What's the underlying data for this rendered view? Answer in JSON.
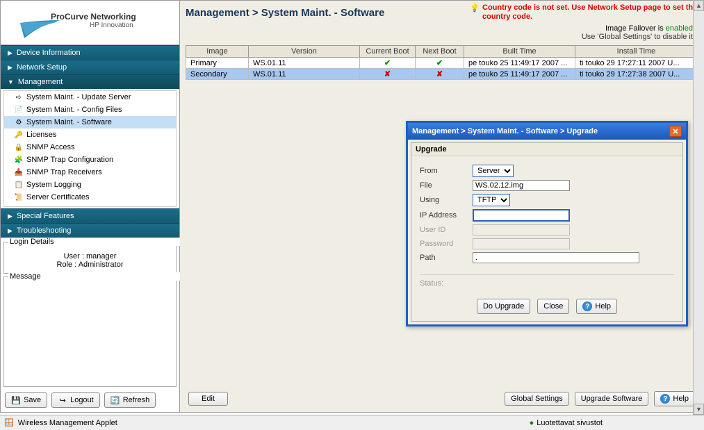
{
  "logo": {
    "brand": "ProCurve Networking",
    "sub": "HP Innovation"
  },
  "nav": {
    "device_info": "Device Information",
    "network_setup": "Network Setup",
    "management": "Management",
    "special_features": "Special Features",
    "troubleshooting": "Troubleshooting"
  },
  "tree": {
    "items": [
      {
        "label": "System Maint. - Update Server"
      },
      {
        "label": "System Maint. - Config Files"
      },
      {
        "label": "System Maint. - Software"
      },
      {
        "label": "Licenses"
      },
      {
        "label": "SNMP Access"
      },
      {
        "label": "SNMP Trap Configuration"
      },
      {
        "label": "SNMP Trap Receivers"
      },
      {
        "label": "System Logging"
      },
      {
        "label": "Server Certificates"
      }
    ]
  },
  "login": {
    "legend": "Login Details",
    "user_label": "User : ",
    "user": "manager",
    "role_label": "Role : ",
    "role": "Administrator"
  },
  "message": {
    "legend": "Message"
  },
  "side_buttons": {
    "save": "Save",
    "logout": "Logout",
    "refresh": "Refresh"
  },
  "header": {
    "breadcrumb": "Management > System Maint. - Software",
    "warn": "Country code is not set. Use Network Setup page to set the country code.",
    "failover_prefix": "Image Failover is ",
    "failover_state": "enabled",
    "failover_suffix": ".",
    "failover_sub": "Use 'Global Settings' to disable it."
  },
  "table": {
    "cols": {
      "image": "Image",
      "version": "Version",
      "current": "Current Boot",
      "next": "Next Boot",
      "built": "Built Time",
      "install": "Install Time"
    },
    "rows": [
      {
        "image": "Primary",
        "version": "WS.01.11",
        "current": "✔",
        "next": "✔",
        "built": "pe touko 25 11:49:17 2007 ...",
        "install": "ti touko 29 17:27:11 2007 U...",
        "sel": false,
        "ok": true
      },
      {
        "image": "Secondary",
        "version": "WS.01.11",
        "current": "✘",
        "next": "✘",
        "built": "pe touko 25 11:49:17 2007 ...",
        "install": "ti touko 29 17:27:38 2007 U...",
        "sel": true,
        "ok": false
      }
    ]
  },
  "dialog": {
    "title": "Management  > System Maint.  - Software  > Upgrade",
    "section": "Upgrade",
    "from_label": "From",
    "from_value": "Server",
    "file_label": "File",
    "file_value": "WS.02.12.img",
    "using_label": "Using",
    "using_value": "TFTP",
    "ip_label": "IP Address",
    "ip_value": "",
    "user_label": "User ID",
    "user_value": "",
    "pass_label": "Password",
    "pass_value": "",
    "path_label": "Path",
    "path_value": ".",
    "status_label": "Status:",
    "do_upgrade": "Do Upgrade",
    "close": "Close",
    "help": "Help"
  },
  "bottom": {
    "edit": "Edit",
    "global": "Global Settings",
    "upgrade": "Upgrade Software",
    "help": "Help"
  },
  "statusbar": {
    "applet": "Wireless Management Applet",
    "trusted": "Luotettavat sivustot"
  }
}
